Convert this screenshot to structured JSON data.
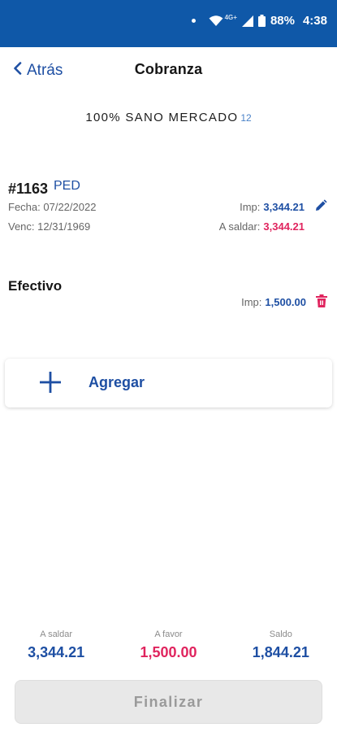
{
  "status_bar": {
    "network": "4G+",
    "battery": "88%",
    "time": "4:38"
  },
  "header": {
    "back_label": "Atrás",
    "title": "Cobranza"
  },
  "client": {
    "name": "100% SANO MERCADO",
    "number": "12"
  },
  "document": {
    "id": "#1163",
    "type": "PED",
    "fecha_label": "Fecha:",
    "fecha_value": "07/22/2022",
    "venc_label": "Venc:",
    "venc_value": "12/31/1969",
    "imp_label": "Imp:",
    "imp_value": "3,344.21",
    "saldar_label": "A saldar:",
    "saldar_value": "3,344.21"
  },
  "payment": {
    "method": "Efectivo",
    "imp_label": "Imp:",
    "imp_value": "1,500.00"
  },
  "add": {
    "label": "Agregar"
  },
  "totals": {
    "a_saldar_label": "A saldar",
    "a_saldar_value": "3,344.21",
    "a_favor_label": "A favor",
    "a_favor_value": "1,500.00",
    "saldo_label": "Saldo",
    "saldo_value": "1,844.21"
  },
  "finalize": {
    "label": "Finalizar"
  },
  "colors": {
    "primary": "#1e4fa3",
    "status_bar": "#0f58a8",
    "accent_red": "#e0245e",
    "disabled": "#e8e8e8"
  }
}
